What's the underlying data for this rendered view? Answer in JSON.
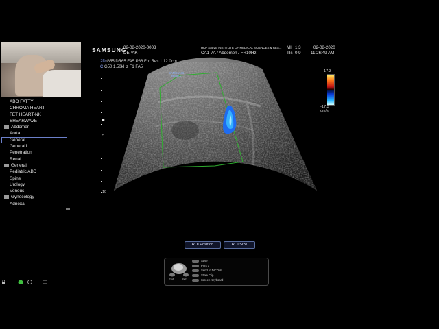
{
  "header": {
    "brand": "SAMSUNG",
    "patient_id": "02-08-2020-0003",
    "patient_name": "DEPAK",
    "institution": "HKP SALVE INSTITUTE OF MEDICAL SCIENCES & RES...",
    "probe_preset": "CA1-7A / Abdomen / FR10Hz",
    "mi_label": "MI",
    "mi_value": "1.3",
    "tis_label": "TIs",
    "tis_value": "0.9",
    "date": "02-08-2020",
    "time": "11:26:49 AM"
  },
  "info": {
    "line1_prefix": "2D",
    "line1": "G55 DR65 FA5 P86 Frq Res.1 12.0cm",
    "line2_prefix": "C",
    "line2": "G50 1.50kHz F1 FA5"
  },
  "image_logo": {
    "brand": "SAMSUNG",
    "sub": "RS80A"
  },
  "depth_labels": {
    "mid": "5",
    "bottom": "10"
  },
  "colorbar": {
    "top": "17.3",
    "bottom": "-17.3",
    "unit": "cm/s"
  },
  "presets": [
    {
      "label": "ABO FATTY",
      "type": "item"
    },
    {
      "label": "CHROMA HEART",
      "type": "item"
    },
    {
      "label": "FET HEART-NK",
      "type": "item"
    },
    {
      "label": "SHEARWAVE",
      "type": "item"
    },
    {
      "label": "Abdomen",
      "type": "folder"
    },
    {
      "label": "Aorta",
      "type": "item"
    },
    {
      "label": "General",
      "type": "selected"
    },
    {
      "label": "General1",
      "type": "item"
    },
    {
      "label": "Penetration",
      "type": "item"
    },
    {
      "label": "Renal",
      "type": "item"
    },
    {
      "label": "General",
      "type": "folder"
    },
    {
      "label": "Pediatric ABD",
      "type": "item"
    },
    {
      "label": "Spine",
      "type": "item"
    },
    {
      "label": "Urology",
      "type": "item"
    },
    {
      "label": "Venous",
      "type": "item"
    },
    {
      "label": "Gynecology",
      "type": "folder"
    },
    {
      "label": "Adnexa",
      "type": "item"
    }
  ],
  "roi_buttons": {
    "position": "ROI Position",
    "size": "ROI Size"
  },
  "keys": {
    "exit": "Exit",
    "set": "Set",
    "items": [
      "Save",
      "Print 1",
      "Send to DICOM",
      "Store Clip",
      "Screen Keyboard"
    ]
  },
  "colors": {
    "roi_box": "#2fae2f",
    "selection": "#6b7fc9",
    "flow_blue": "#2a8cff"
  }
}
